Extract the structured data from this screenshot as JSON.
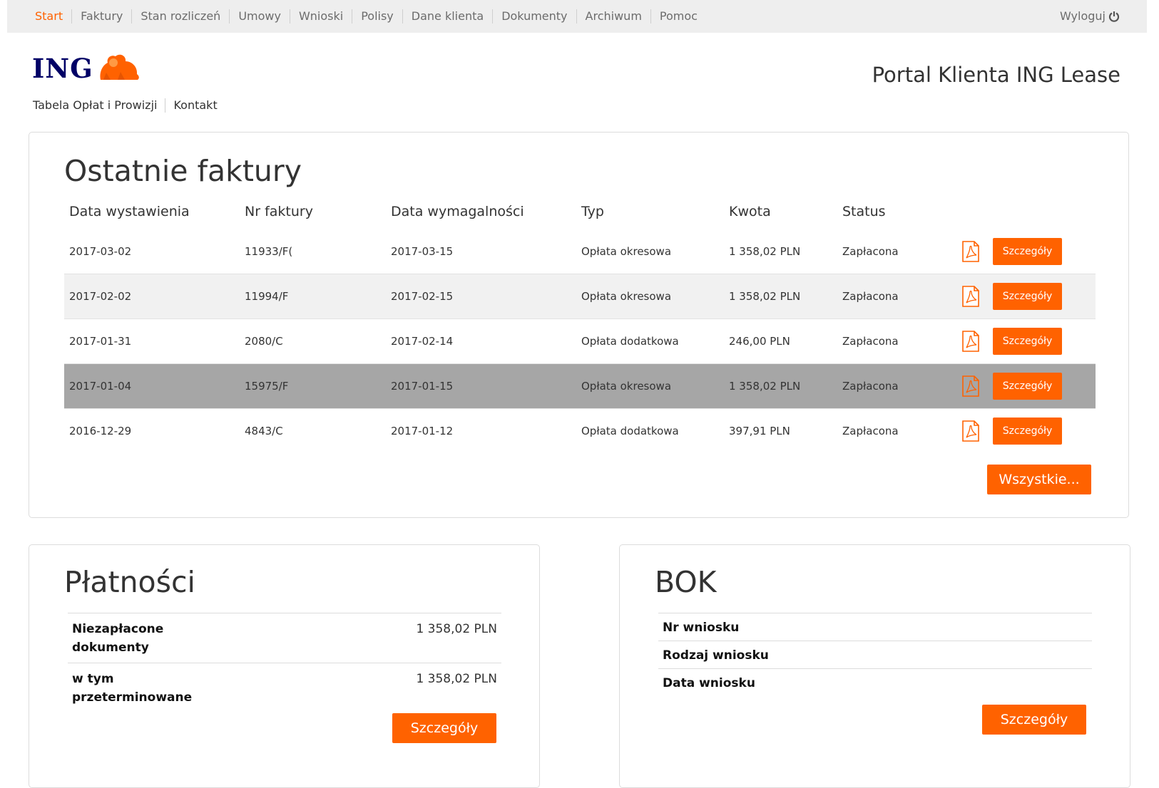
{
  "nav": {
    "items": [
      "Start",
      "Faktury",
      "Stan rozliczeń",
      "Umowy",
      "Wnioski",
      "Polisy",
      "Dane klienta",
      "Dokumenty",
      "Archiwum",
      "Pomoc"
    ],
    "logout": "Wyloguj"
  },
  "header": {
    "logo_text": "ING",
    "links": [
      "Tabela Opłat i Prowizji",
      "Kontakt"
    ],
    "portal_title": "Portal Klienta ING Lease"
  },
  "invoices": {
    "title": "Ostatnie faktury",
    "columns": [
      "Data wystawienia",
      "Nr faktury",
      "Data wymagalności",
      "Typ",
      "Kwota",
      "Status"
    ],
    "rows": [
      {
        "date": "2017-03-02",
        "number": "11933/F(",
        "due": "2017-03-15",
        "type": "Opłata okresowa",
        "amount": "1 358,02 PLN",
        "status": "Zapłacona",
        "details": "Szczegóły"
      },
      {
        "date": "2017-02-02",
        "number": "11994/F",
        "due": "2017-02-15",
        "type": "Opłata okresowa",
        "amount": "1 358,02 PLN",
        "status": "Zapłacona",
        "details": "Szczegóły"
      },
      {
        "date": "2017-01-31",
        "number": "2080/C",
        "due": "2017-02-14",
        "type": "Opłata dodatkowa",
        "amount": "246,00 PLN",
        "status": "Zapłacona",
        "details": "Szczegóły"
      },
      {
        "date": "2017-01-04",
        "number": "15975/F",
        "due": "2017-01-15",
        "type": "Opłata okresowa",
        "amount": "1 358,02 PLN",
        "status": "Zapłacona",
        "details": "Szczegóły"
      },
      {
        "date": "2016-12-29",
        "number": "4843/C",
        "due": "2017-01-12",
        "type": "Opłata dodatkowa",
        "amount": "397,91 PLN",
        "status": "Zapłacona",
        "details": "Szczegóły"
      }
    ],
    "all_button": "Wszystkie..."
  },
  "payments": {
    "title": "Płatności",
    "rows": [
      {
        "label": "Niezapłacone dokumenty",
        "value": "1 358,02 PLN"
      },
      {
        "label": "w tym przeterminowane",
        "value": "1 358,02 PLN"
      }
    ],
    "details_button": "Szczegóły"
  },
  "bok": {
    "title": "BOK",
    "rows": [
      "Nr wniosku",
      "Rodzaj wniosku",
      "Data wniosku"
    ],
    "details_button": "Szczegóły"
  },
  "colors": {
    "accent": "#ff6200",
    "logo_blue": "#000066",
    "row_highlight": "#a6a6a6",
    "row_alt": "#f1f1f1"
  },
  "icons": {
    "logout": "power-icon",
    "logo": "lion-icon",
    "invoice_file": "pdf-icon"
  }
}
